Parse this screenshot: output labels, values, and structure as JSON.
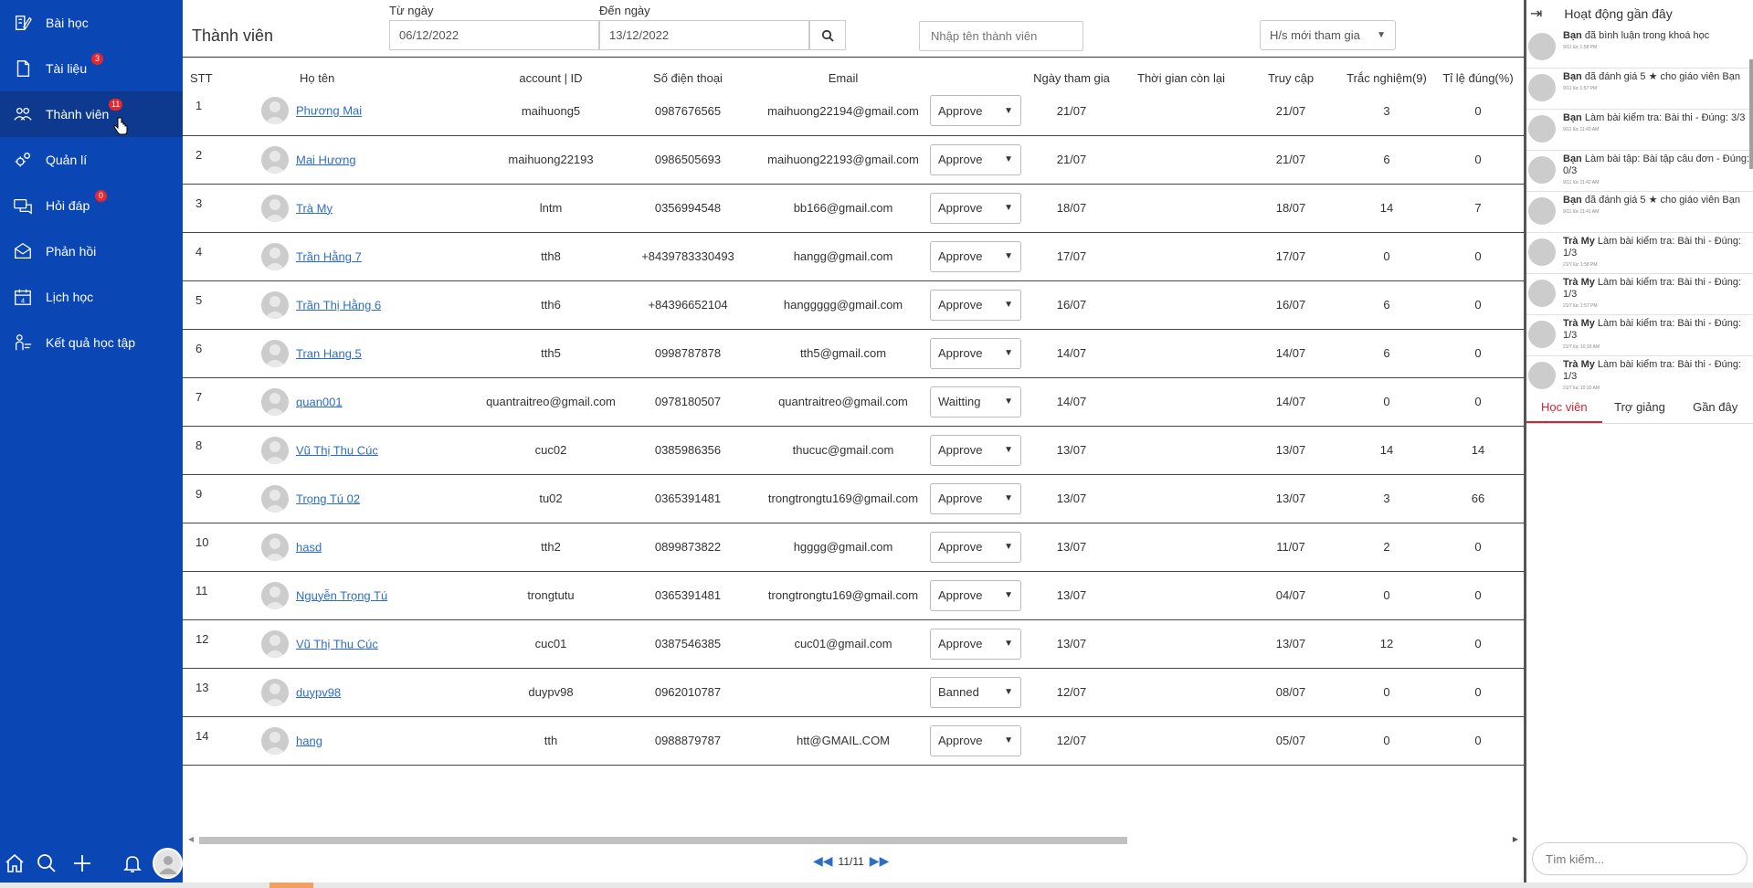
{
  "sidebar": {
    "items": [
      {
        "label": "Bài học",
        "icon": "lesson-icon",
        "badge": ""
      },
      {
        "label": "Tài liệu",
        "icon": "document-icon",
        "badge": "3"
      },
      {
        "label": "Thành viên",
        "icon": "members-icon",
        "badge": "11"
      },
      {
        "label": "Quản lí",
        "icon": "manage-icon",
        "badge": ""
      },
      {
        "label": "Hỏi đáp",
        "icon": "qa-icon",
        "badge": "0"
      },
      {
        "label": "Phản hồi",
        "icon": "feedback-icon",
        "badge": ""
      },
      {
        "label": "Lịch học",
        "icon": "calendar-icon",
        "badge": ""
      },
      {
        "label": "Kết quả học tập",
        "icon": "results-icon",
        "badge": ""
      }
    ],
    "active_index": 2,
    "bottom_icons": [
      "home-icon",
      "search-icon",
      "plus-icon",
      "bell-icon",
      "avatar"
    ]
  },
  "header": {
    "title": "Thành viên",
    "from_label": "Từ ngày",
    "from_value": "06/12/2022",
    "to_label": "Đến ngày",
    "to_value": "13/12/2022",
    "member_search_placeholder": "Nhập tên thành viên",
    "filter_value": "H/s mới tham gia"
  },
  "table": {
    "columns": [
      "STT",
      "Họ tên",
      "account | ID",
      "Số điện thoại",
      "Email",
      "",
      "Ngày tham gia",
      "Thời gian còn lại",
      "Truy cập",
      "Trắc nghiệm(9)",
      "Tỉ lệ đúng(%)"
    ],
    "rows": [
      {
        "stt": "1",
        "name": "Phương Mai",
        "account": "maihuong5",
        "phone": "0987676565",
        "email": "maihuong22194@gmail.com",
        "status": "Approve",
        "joined": "21/07",
        "remaining": "",
        "access": "21/07",
        "quiz": "3",
        "ratio": "0"
      },
      {
        "stt": "2",
        "name": "Mai Hương",
        "account": "maihuong22193",
        "phone": "0986505693",
        "email": "maihuong22193@gmail.com",
        "status": "Approve",
        "joined": "21/07",
        "remaining": "",
        "access": "21/07",
        "quiz": "6",
        "ratio": "0"
      },
      {
        "stt": "3",
        "name": "Trà My",
        "account": "lntm",
        "phone": "0356994548",
        "email": "bb166@gmail.com",
        "status": "Approve",
        "joined": "18/07",
        "remaining": "",
        "access": "18/07",
        "quiz": "14",
        "ratio": "7"
      },
      {
        "stt": "4",
        "name": "Trần Hằng 7",
        "account": "tth8",
        "phone": "+8439783330493",
        "email": "hangg@gmail.com",
        "status": "Approve",
        "joined": "17/07",
        "remaining": "",
        "access": "17/07",
        "quiz": "0",
        "ratio": "0"
      },
      {
        "stt": "5",
        "name": "Trần Thị Hằng 6",
        "account": "tth6",
        "phone": "+84396652104",
        "email": "hanggggg@gmail.com",
        "status": "Approve",
        "joined": "16/07",
        "remaining": "",
        "access": "16/07",
        "quiz": "6",
        "ratio": "0"
      },
      {
        "stt": "6",
        "name": "Tran Hang 5",
        "account": "tth5",
        "phone": "0998787878",
        "email": "tth5@gmail.com",
        "status": "Approve",
        "joined": "14/07",
        "remaining": "",
        "access": "14/07",
        "quiz": "6",
        "ratio": "0"
      },
      {
        "stt": "7",
        "name": "quan001",
        "account": "quantraitreo@gmail.com",
        "phone": "0978180507",
        "email": "quantraitreo@gmail.com",
        "status": "Waitting",
        "joined": "14/07",
        "remaining": "",
        "access": "14/07",
        "quiz": "0",
        "ratio": "0"
      },
      {
        "stt": "8",
        "name": "Vũ Thị Thu Cúc",
        "account": "cuc02",
        "phone": "0385986356",
        "email": "thucuc@gmail.com",
        "status": "Approve",
        "joined": "13/07",
        "remaining": "",
        "access": "13/07",
        "quiz": "14",
        "ratio": "14"
      },
      {
        "stt": "9",
        "name": "Trọng Tú 02",
        "account": "tu02",
        "phone": "0365391481",
        "email": "trongtrongtu169@gmail.com",
        "status": "Approve",
        "joined": "13/07",
        "remaining": "",
        "access": "13/07",
        "quiz": "3",
        "ratio": "66"
      },
      {
        "stt": "10",
        "name": "hasd",
        "account": "tth2",
        "phone": "0899873822",
        "email": "hgggg@gmail.com",
        "status": "Approve",
        "joined": "13/07",
        "remaining": "",
        "access": "11/07",
        "quiz": "2",
        "ratio": "0"
      },
      {
        "stt": "11",
        "name": "Nguyễn Trọng Tú",
        "account": "trongtutu",
        "phone": "0365391481",
        "email": "trongtrongtu169@gmail.com",
        "status": "Approve",
        "joined": "13/07",
        "remaining": "",
        "access": "04/07",
        "quiz": "0",
        "ratio": "0"
      },
      {
        "stt": "12",
        "name": "Vũ Thị Thu Cúc",
        "account": "cuc01",
        "phone": "0387546385",
        "email": "cuc01@gmail.com",
        "status": "Approve",
        "joined": "13/07",
        "remaining": "",
        "access": "13/07",
        "quiz": "12",
        "ratio": "0"
      },
      {
        "stt": "13",
        "name": "duypv98",
        "account": "duypv98",
        "phone": "0962010787",
        "email": "",
        "status": "Banned",
        "joined": "12/07",
        "remaining": "",
        "access": "08/07",
        "quiz": "0",
        "ratio": "0"
      },
      {
        "stt": "14",
        "name": "hang",
        "account": "tth",
        "phone": "0988879787",
        "email": "htt@GMAIL.COM",
        "status": "Approve",
        "joined": "12/07",
        "remaining": "",
        "access": "05/07",
        "quiz": "0",
        "ratio": "0"
      }
    ]
  },
  "pager": {
    "label": "11/11"
  },
  "right_panel": {
    "title": "Hoạt động gần đây",
    "activities": [
      {
        "actor": "Bạn",
        "text": "đã bình luận trong khoá học",
        "time": "9/11 lúc 1:58 PM"
      },
      {
        "actor": "Bạn",
        "text": "đã đánh giá 5 ★ cho giáo viên Bạn",
        "time": "9/11 lúc 1:57 PM"
      },
      {
        "actor": "Bạn",
        "text": "Làm bài kiểm tra: Bài thi - Đúng: 3/3",
        "time": "9/11 lúc 11:43 AM"
      },
      {
        "actor": "Bạn",
        "text": "Làm bài tập: Bài tập câu đơn - Đúng: 0/3",
        "time": "9/11 lúc 11:42 AM"
      },
      {
        "actor": "Bạn",
        "text": "đã đánh giá 5 ★ cho giáo viên Bạn",
        "time": "9/11 lúc 11:41 AM"
      },
      {
        "actor": "Trà My",
        "text": "Làm bài kiểm tra: Bài thi - Đúng: 1/3",
        "time": "21/7 lúc 1:58 PM"
      },
      {
        "actor": "Trà My",
        "text": "Làm bài kiểm tra: Bài thi - Đúng: 1/3",
        "time": "21/7 lúc 1:57 PM"
      },
      {
        "actor": "Trà My",
        "text": "Làm bài kiểm tra: Bài thi - Đúng: 1/3",
        "time": "21/7 lúc 10:10 AM"
      },
      {
        "actor": "Trà My",
        "text": "Làm bài kiểm tra: Bài thi - Đúng: 1/3",
        "time": "21/7 lúc 10:10 AM"
      }
    ],
    "tabs": [
      "Học viên",
      "Trợ giảng",
      "Gần đây"
    ],
    "active_tab": 0,
    "search_placeholder": "Tìm kiếm..."
  },
  "colors": {
    "sidebar": "#0a47b4",
    "sidebar_active": "#0d3a8f",
    "link": "#2e6dc4",
    "badge": "#e8262e",
    "tab_active": "#dd2233"
  }
}
